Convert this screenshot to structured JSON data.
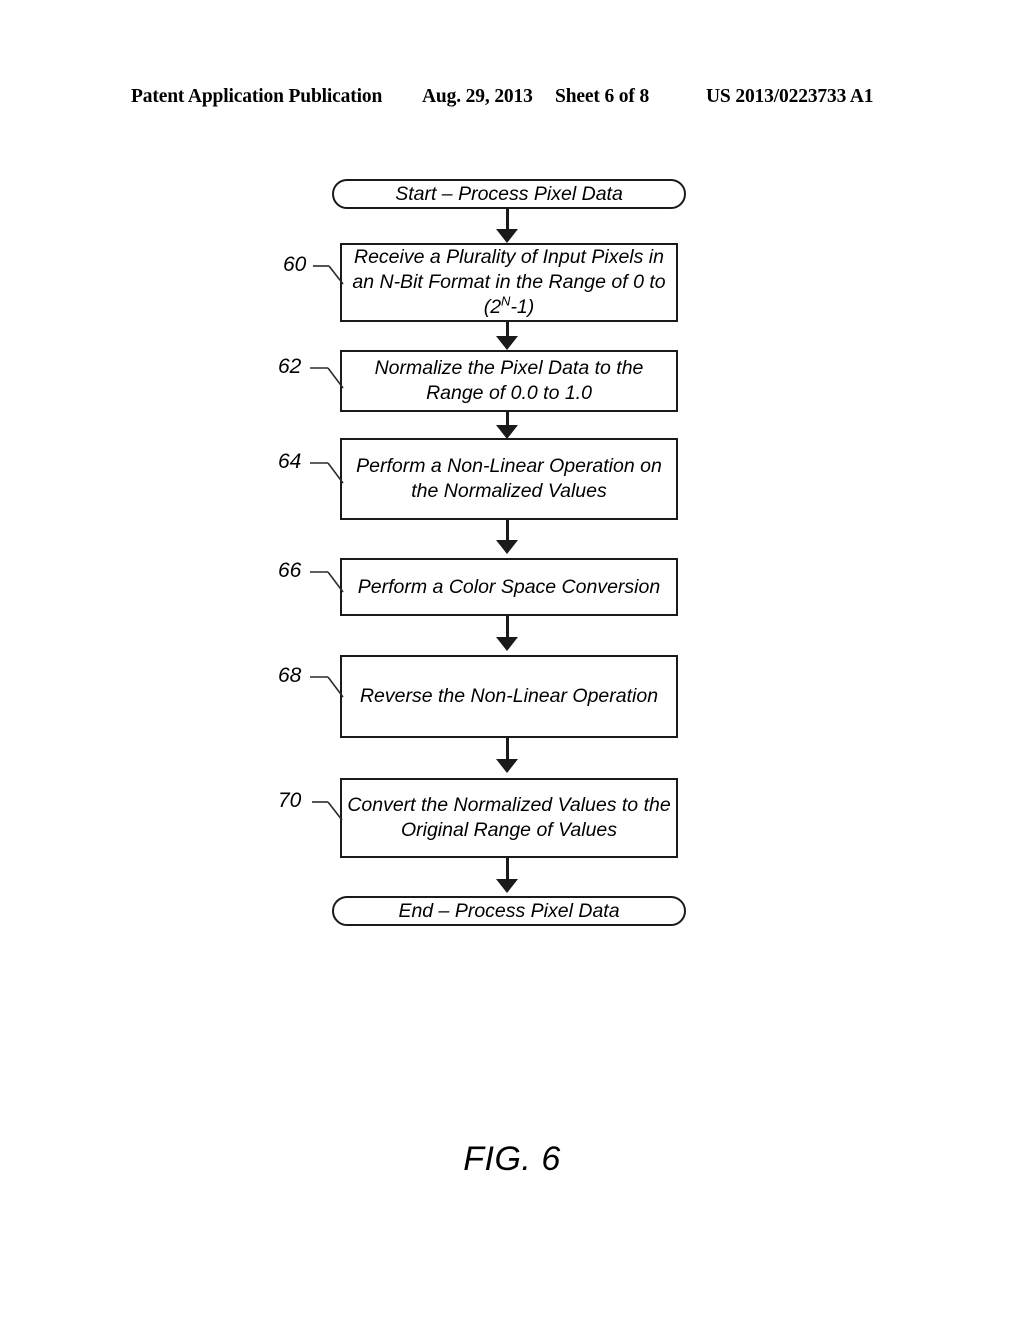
{
  "header": {
    "publication": "Patent Application Publication",
    "date": "Aug. 29, 2013",
    "sheet": "Sheet 6 of 8",
    "patent_number": "US 2013/0223733 A1"
  },
  "figure": {
    "caption": "FIG. 6",
    "type": "flowchart",
    "title": "Process Pixel Data"
  },
  "flowchart": {
    "nodes": [
      {
        "id": "start",
        "shape": "terminator",
        "label": "Start – Process Pixel Data",
        "ref": ""
      },
      {
        "id": "step-60",
        "shape": "process",
        "label_line1": "Receive a Plurality of Input Pixels in",
        "label_line2": "an N-Bit Format in the Range of 0 to",
        "label_line3_pre": "(2",
        "label_line3_sup": "N",
        "label_line3_post": "-1)",
        "label": "Receive a Plurality of Input Pixels in an N-Bit Format in the Range of 0 to (2N-1)",
        "ref": "60"
      },
      {
        "id": "step-62",
        "shape": "process",
        "label": "Normalize the Pixel Data to the Range of 0.0 to 1.0",
        "ref": "62"
      },
      {
        "id": "step-64",
        "shape": "process",
        "label": "Perform a Non-Linear Operation on the Normalized Values",
        "ref": "64"
      },
      {
        "id": "step-66",
        "shape": "process",
        "label": "Perform a Color Space Conversion",
        "ref": "66"
      },
      {
        "id": "step-68",
        "shape": "process",
        "label": "Reverse the Non-Linear Operation",
        "ref": "68"
      },
      {
        "id": "step-70",
        "shape": "process",
        "label": "Convert the Normalized Values to the Original Range of Values",
        "ref": "70"
      },
      {
        "id": "end",
        "shape": "terminator",
        "label": "End – Process Pixel Data",
        "ref": ""
      }
    ],
    "edges": [
      {
        "from": "start",
        "to": "step-60"
      },
      {
        "from": "step-60",
        "to": "step-62"
      },
      {
        "from": "step-62",
        "to": "step-64"
      },
      {
        "from": "step-64",
        "to": "step-66"
      },
      {
        "from": "step-66",
        "to": "step-68"
      },
      {
        "from": "step-68",
        "to": "step-70"
      },
      {
        "from": "step-70",
        "to": "end"
      }
    ]
  },
  "colors": {
    "ink": "#1a1a1a",
    "paper": "#ffffff"
  }
}
